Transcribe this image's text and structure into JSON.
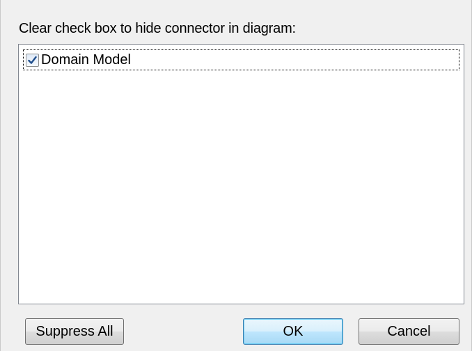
{
  "dialog": {
    "instruction": "Clear check box to hide connector in diagram:"
  },
  "connectors": [
    {
      "label": "Domain Model",
      "checked": true
    }
  ],
  "buttons": {
    "suppress_all": "Suppress All",
    "ok": "OK",
    "cancel": "Cancel"
  },
  "icons": {
    "checkmark": "checkmark-icon"
  },
  "colors": {
    "dialog_bg": "#f0f0f0",
    "list_bg": "#ffffff",
    "check_color": "#1f4e8c",
    "default_button_border": "#3c7fb1"
  }
}
